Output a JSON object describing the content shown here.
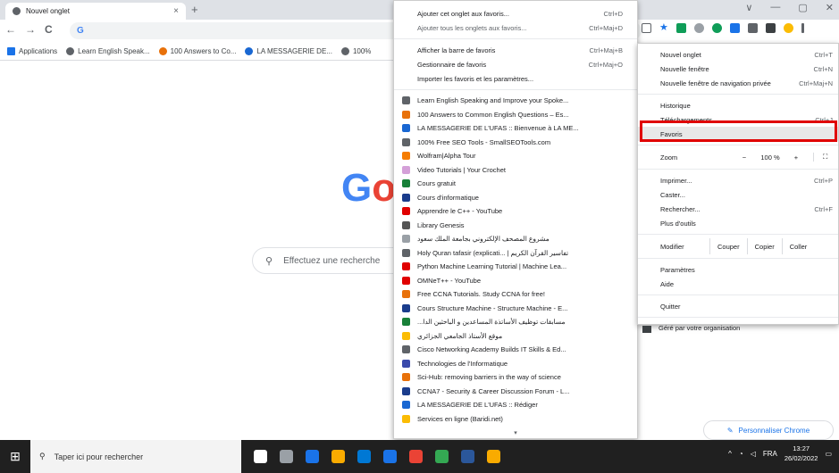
{
  "tab": {
    "title": "Nouvel onglet",
    "close": "×",
    "new_tab": "+"
  },
  "window_controls": [
    "∨",
    "—",
    "▢",
    "✕"
  ],
  "nav": {
    "back": "←",
    "forward": "→",
    "reload": "C",
    "omnibox_text": "G"
  },
  "bookmarks_bar": [
    {
      "label": "Applications",
      "color": "#1a73e8"
    },
    {
      "label": "Learn English Speak...",
      "color": "#5f6368"
    },
    {
      "label": "100 Answers to Co...",
      "color": "#e8710a"
    },
    {
      "label": "LA MESSAGERIE DE...",
      "color": "#1967d2"
    },
    {
      "label": "100%",
      "color": "#5f6368"
    }
  ],
  "bookmarks_menu": {
    "top_items": [
      {
        "label": "Ajouter cet onglet aux favoris...",
        "shortcut": "Ctrl+D",
        "disabled": false
      },
      {
        "label": "Ajouter tous les onglets aux favoris...",
        "shortcut": "Ctrl+Maj+D",
        "disabled": true
      }
    ],
    "mid_items": [
      {
        "label": "Afficher la barre de favoris",
        "shortcut": "Ctrl+Maj+B"
      },
      {
        "label": "Gestionnaire de favoris",
        "shortcut": "Ctrl+Maj+O"
      },
      {
        "label": "Importer les favoris et les paramètres...",
        "shortcut": ""
      }
    ],
    "bookmarks": [
      {
        "label": "Learn English Speaking and Improve your Spoke...",
        "color": "#5f6368"
      },
      {
        "label": "100 Answers to Common English Questions – Es...",
        "color": "#e8710a"
      },
      {
        "label": "LA MESSAGERIE DE L'UFAS :: Bienvenue à LA ME...",
        "color": "#1967d2"
      },
      {
        "label": "100% Free SEO Tools - SmallSEOTools.com",
        "color": "#5f6368"
      },
      {
        "label": "Wolfram|Alpha Tour",
        "color": "#f57c00"
      },
      {
        "label": "Video Tutorials | Your Crochet",
        "color": "#d4a0d8"
      },
      {
        "label": "Cours gratuit",
        "color": "#188038"
      },
      {
        "label": "Cours d'informatique",
        "color": "#1a3c8c"
      },
      {
        "label": "Apprendre le C++ - YouTube",
        "color": "#e00000"
      },
      {
        "label": "Library Genesis",
        "color": "#555555"
      },
      {
        "label": "مشروع المصحف الإلكتروني بجامعة الملك سعود",
        "color": "#9aa0a6"
      },
      {
        "label": "Holy Quran tafasir (explicati... | تفاسير القرآن الكريم",
        "color": "#5f6368"
      },
      {
        "label": "Python Machine Learning Tutorial | Machine Lea...",
        "color": "#e00000"
      },
      {
        "label": "OMNeT++ - YouTube",
        "color": "#e00000"
      },
      {
        "label": "Free CCNA Tutorials. Study CCNA for free!",
        "color": "#e8710a"
      },
      {
        "label": "Cours Structure Machine - Structure Machine - E...",
        "color": "#1a3c8c"
      },
      {
        "label": "...مسابقات توظيف الأساتذة المساعدين و الباحثين الدا",
        "color": "#188038"
      },
      {
        "label": "موقع الأستاذ الجامعي الجزائري",
        "color": "#fbbc04"
      },
      {
        "label": "Cisco Networking Academy Builds IT Skills & Ed...",
        "color": "#5f6368"
      },
      {
        "label": "Technologies de l'Informatique",
        "color": "#3949ab"
      },
      {
        "label": "Sci-Hub: removing barriers in the way of science",
        "color": "#e8710a"
      },
      {
        "label": "CCNA7 - Security & Career Discussion Forum - L...",
        "color": "#1a3c8c"
      },
      {
        "label": "LA MESSAGERIE DE L'UFAS :: Rédiger",
        "color": "#1967d2"
      },
      {
        "label": "Services en ligne (Baridi.net)",
        "color": "#fbbc04"
      }
    ],
    "scroll_arrow": "▾"
  },
  "chrome_menu": {
    "group1": [
      {
        "label": "Nouvel onglet",
        "shortcut": "Ctrl+T"
      },
      {
        "label": "Nouvelle fenêtre",
        "shortcut": "Ctrl+N"
      },
      {
        "label": "Nouvelle fenêtre de navigation privée",
        "shortcut": "Ctrl+Maj+N"
      }
    ],
    "group2": [
      {
        "label": "Historique",
        "shortcut": ""
      },
      {
        "label": "Téléchargements",
        "shortcut": "Ctrl+J"
      },
      {
        "label": "Favoris",
        "shortcut": ""
      }
    ],
    "zoom": {
      "label": "Zoom",
      "minus": "−",
      "value": "100 %",
      "plus": "+",
      "fullscreen": "⛶"
    },
    "group3": [
      {
        "label": "Imprimer...",
        "shortcut": "Ctrl+P"
      },
      {
        "label": "Caster...",
        "shortcut": ""
      },
      {
        "label": "Rechercher...",
        "shortcut": "Ctrl+F"
      },
      {
        "label": "Plus d'outils",
        "shortcut": ""
      }
    ],
    "edit": {
      "label": "Modifier",
      "cut": "Couper",
      "copy": "Copier",
      "paste": "Coller"
    },
    "group4": [
      {
        "label": "Paramètres",
        "shortcut": ""
      },
      {
        "label": "Aide",
        "shortcut": ""
      }
    ],
    "quit": "Quitter",
    "managed": "Géré par votre organisation"
  },
  "page": {
    "logo_G": "G",
    "logo_o": "o",
    "search_placeholder": "Effectuez une recherche",
    "customize": "Personnaliser Chrome"
  },
  "taskbar": {
    "search_placeholder": "Taper ici pour rechercher",
    "lang": "FRA",
    "time": "13:27",
    "date": "26/02/2022",
    "app_colors": [
      "#ffffff",
      "#9aa0a6",
      "#1a73e8",
      "#f9ab00",
      "#0078d4",
      "#1a73e8",
      "#ea4335",
      "#34a853",
      "#2b579a",
      "#f9ab00"
    ]
  },
  "colors": {
    "highlight": "#e00000",
    "accent": "#1a73e8"
  }
}
